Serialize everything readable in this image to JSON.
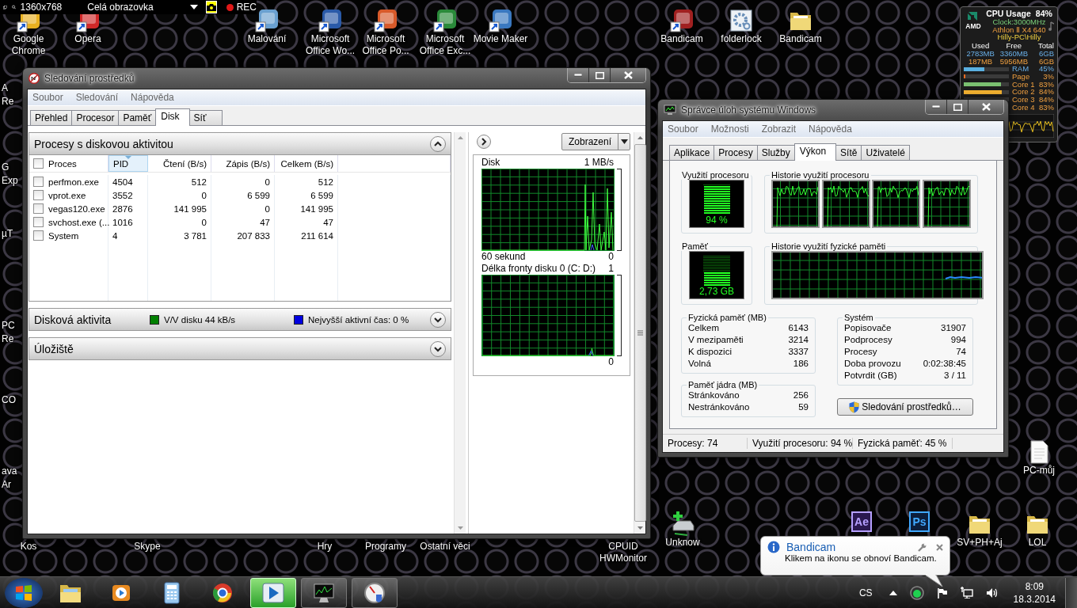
{
  "recorder_bar": {
    "resolution": "1360x768",
    "mode": "Celá obrazovka",
    "record": "REC"
  },
  "desktop_icons": [
    {
      "label": "Google Chrome"
    },
    {
      "label": "Opera"
    },
    {
      "label": "Malování"
    },
    {
      "label": "Microsoft Office Wo..."
    },
    {
      "label": "Microsoft Office Po..."
    },
    {
      "label": "Microsoft Office Exc..."
    },
    {
      "label": "Movie Maker"
    },
    {
      "label": "Bandicam"
    },
    {
      "label": "folderlock"
    },
    {
      "label": "Bandicam"
    },
    {
      "label": "PC-můj"
    },
    {
      "label": "Kos"
    },
    {
      "label": "Skype"
    },
    {
      "label": "Hry"
    },
    {
      "label": "Programy"
    },
    {
      "label": "Ostatní věci"
    },
    {
      "label": "CPUID HWMonitor"
    },
    {
      "label": "Unknow"
    },
    {
      "label": "SV+PH+Aj"
    },
    {
      "label": "LOL"
    }
  ],
  "app_tiles": [
    {
      "text": "Ae"
    },
    {
      "text": "Ps"
    }
  ],
  "edge_icons": [
    {
      "lines": [
        "A",
        "Re"
      ]
    },
    {
      "lines": [
        "G",
        "Exp"
      ]
    },
    {
      "lines": [
        "µT"
      ]
    },
    {
      "lines": [
        "PC",
        "Re"
      ]
    },
    {
      "lines": [
        "CO"
      ]
    },
    {
      "lines": [
        "ava",
        "Ar"
      ]
    }
  ],
  "gadget": {
    "logo": "AMD",
    "title": "CPU Usage",
    "value": "84%",
    "clock": "Clock:3000MHz",
    "cpu": "Athlon Ⅱ X4 640",
    "user": "Hilly-PC\\Hilly",
    "columns": [
      "Used",
      "Free",
      "Total"
    ],
    "rows": [
      [
        "2783MB",
        "3360MB",
        "6GB"
      ],
      [
        "187MB",
        "5956MB",
        "6GB"
      ]
    ],
    "meters": [
      {
        "label": "RAM",
        "reading": "45%",
        "level": 0.45,
        "color": "#5ab0e0"
      },
      {
        "label": "Page",
        "reading": "3%",
        "level": 0.03,
        "color": "#e86a20"
      },
      {
        "label": "Core 1",
        "reading": "83%",
        "level": 0.83,
        "color": "#7ac070"
      },
      {
        "label": "Core 2",
        "reading": "84%",
        "level": 0.84,
        "color": "#f0b030"
      },
      {
        "label": "Core 3",
        "reading": "84%"
      },
      {
        "label": "Core 4",
        "reading": "83%"
      }
    ]
  },
  "resource_monitor": {
    "title": "Sledování prostředků",
    "menu": [
      "Soubor",
      "Sledování",
      "Nápověda"
    ],
    "tabs": [
      {
        "label": "Přehled",
        "selected": false
      },
      {
        "label": "Procesor",
        "selected": false
      },
      {
        "label": "Paměť",
        "selected": false
      },
      {
        "label": "Disk",
        "selected": true
      },
      {
        "label": "Síť",
        "selected": false
      }
    ],
    "processes": {
      "title": "Procesy s diskovou aktivitou",
      "expanded": true,
      "all_checked": false,
      "columns": [
        {
          "label": "Proces",
          "sorted": false
        },
        {
          "label": "PID",
          "sorted": true
        },
        {
          "label": "Čtení (B/s)",
          "sorted": false
        },
        {
          "label": "Zápis (B/s)",
          "sorted": false
        },
        {
          "label": "Celkem (B/s)",
          "sorted": false
        }
      ],
      "rows": [
        {
          "checked": false,
          "cells": [
            "perfmon.exe",
            "4504",
            "512",
            "0",
            "512"
          ]
        },
        {
          "checked": false,
          "cells": [
            "vprot.exe",
            "3552",
            "0",
            "6 599",
            "6 599"
          ]
        },
        {
          "checked": false,
          "cells": [
            "vegas120.exe",
            "2876",
            "141 995",
            "0",
            "141 995"
          ]
        },
        {
          "checked": false,
          "cells": [
            "svchost.exe (...",
            "1016",
            "0",
            "47",
            "47"
          ]
        },
        {
          "checked": false,
          "cells": [
            "System",
            "4",
            "3 781",
            "207 833",
            "211 614"
          ]
        }
      ]
    },
    "disk_activity": {
      "title": "Disková aktivita",
      "expanded": false,
      "legend": [
        {
          "label": "V/V disku 44 kB/s",
          "color": "#008000"
        },
        {
          "label": "Nejvyšší aktivní čas: 0 %",
          "color": "#0000e0"
        }
      ]
    },
    "storage": {
      "title": "Úložiště",
      "expanded": false
    },
    "view_button": "Zobrazení",
    "graphs": [
      {
        "title": "Disk",
        "max": "1 MB/s",
        "time": "60 sekund",
        "min": "0"
      },
      {
        "title": "Délka fronty disku 0 (C: D:)",
        "max": "1",
        "min": "0"
      }
    ]
  },
  "task_manager": {
    "title": "Správce úloh systému Windows",
    "menu": [
      "Soubor",
      "Možnosti",
      "Zobrazit",
      "Nápověda"
    ],
    "tabs": [
      {
        "label": "Aplikace",
        "selected": false
      },
      {
        "label": "Procesy",
        "selected": false
      },
      {
        "label": "Služby",
        "selected": false
      },
      {
        "label": "Výkon",
        "selected": true
      },
      {
        "label": "Sítě",
        "selected": false
      },
      {
        "label": "Uživatelé",
        "selected": false
      }
    ],
    "cpu_meter": {
      "title": "Využití procesoru",
      "reading": "94 %",
      "level": 0.94
    },
    "cpu_history": {
      "title": "Historie využití procesoru"
    },
    "memory_meter": {
      "title": "Paměť",
      "reading": "2,73 GB",
      "level": 0.45
    },
    "memory_history": {
      "title": "Historie využití fyzické paměti"
    },
    "physical_memory": {
      "title": "Fyzická paměť (MB)",
      "rows": [
        {
          "label": "Celkem",
          "value": "6143"
        },
        {
          "label": "V mezipaměti",
          "value": "3214"
        },
        {
          "label": "K dispozici",
          "value": "3337"
        },
        {
          "label": "Volná",
          "value": "186"
        }
      ]
    },
    "kernel_memory": {
      "title": "Paměť jádra (MB)",
      "rows": [
        {
          "label": "Stránkováno",
          "value": "256"
        },
        {
          "label": "Nestránkováno",
          "value": "59"
        }
      ]
    },
    "system": {
      "title": "Systém",
      "rows": [
        {
          "label": "Popisovače",
          "value": "31907"
        },
        {
          "label": "Podprocesy",
          "value": "994"
        },
        {
          "label": "Procesy",
          "value": "74"
        },
        {
          "label": "Doba provozu",
          "value": "0:02:38:45"
        },
        {
          "label": "Potvrdit (GB)",
          "value": "3 / 11"
        }
      ]
    },
    "resource_button": "Sledování prostředků…",
    "status_bar": [
      "Procesy: 74",
      "Využití procesoru: 94 %",
      "Fyzická paměť: 45 %"
    ]
  },
  "notification": {
    "title": "Bandicam",
    "message": "Klikem na ikonu se obnoví Bandicam."
  },
  "taskbar": {
    "buttons": [
      {
        "running": false,
        "selected": false
      },
      {
        "running": false,
        "selected": false
      },
      {
        "running": false,
        "selected": false
      },
      {
        "running": false,
        "selected": false
      },
      {
        "running": true,
        "selected": true
      },
      {
        "running": true,
        "selected": false
      },
      {
        "running": true,
        "selected": false
      }
    ],
    "language": "CS",
    "time": "8:09",
    "date": "18.3.2014"
  }
}
